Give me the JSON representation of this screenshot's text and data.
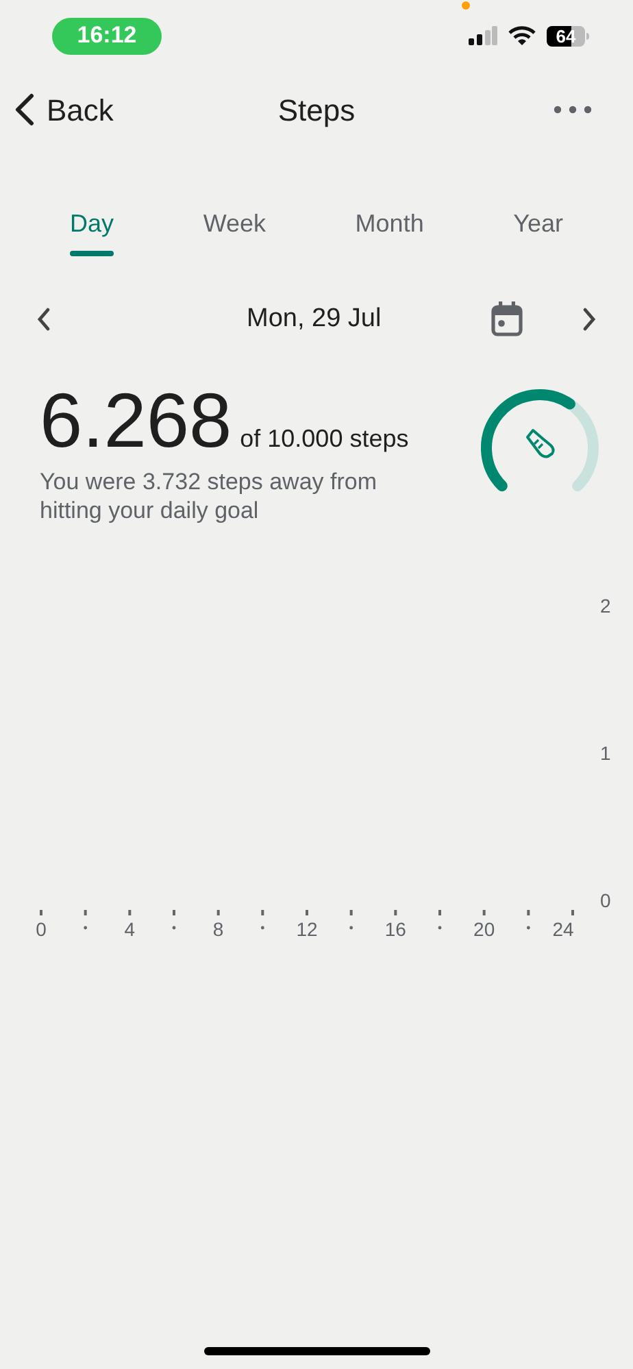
{
  "status_bar": {
    "time": "16:12",
    "battery": "64"
  },
  "nav": {
    "back": "Back",
    "title": "Steps"
  },
  "tabs": [
    {
      "label": "Day",
      "selected": true
    },
    {
      "label": "Week",
      "selected": false
    },
    {
      "label": "Month",
      "selected": false
    },
    {
      "label": "Year",
      "selected": false
    }
  ],
  "date_nav": {
    "date": "Mon, 29 Jul"
  },
  "summary": {
    "steps": "6.268",
    "goal": "of 10.000 steps",
    "message": "You were 3.732 steps away from hitting your daily goal"
  },
  "chart": {
    "chart_data": {
      "type": "bar",
      "xlim": [
        0,
        24
      ],
      "ylim": [
        0,
        2
      ],
      "xticks": [
        0,
        4,
        8,
        12,
        16,
        20,
        24
      ],
      "yticks": [
        0,
        1,
        2
      ]
    }
  }
}
